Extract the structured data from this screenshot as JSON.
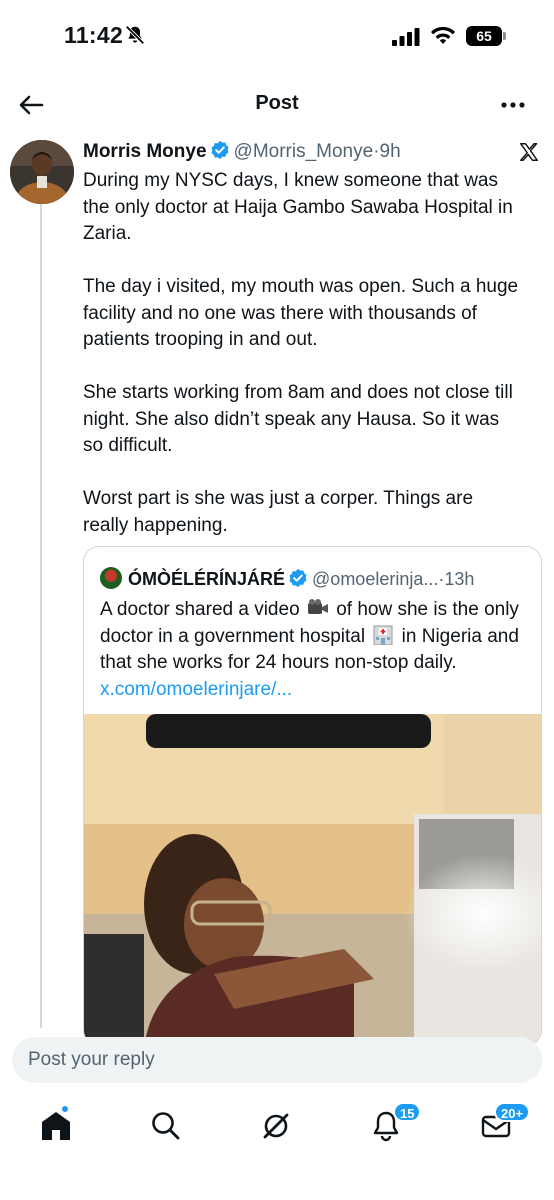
{
  "status_bar": {
    "time": "11:42",
    "battery": "65"
  },
  "header": {
    "title": "Post"
  },
  "tweet": {
    "author_name": "Morris Monye",
    "handle": "@Morris_Monye",
    "separator": "·",
    "time": "9h",
    "paragraphs": [
      "During my NYSC days, I knew someone that was the only doctor at Haija Gambo Sawaba Hospital in Zaria.",
      "The day i visited, my mouth was open. Such a huge facility and no one was there with thousands of patients trooping in and out.",
      "She starts working from 8am and does not close till night. She also didn’t speak any Hausa. So it was so difficult.",
      "Worst part is she was just a corper. Things are really happening."
    ]
  },
  "quote": {
    "author_name": "ÓMÒÉLÉRÍNJÁRÉ",
    "handle": "@omoelerinja...",
    "separator": "·",
    "time": "13h",
    "text_part1": "A doctor shared a video",
    "text_part2": "of how she is the only doctor in a government hospital",
    "text_part3": "in Nigeria and that she works for 24 hours non-stop daily.",
    "link": "x.com/omoelerinjare/..."
  },
  "reply": {
    "placeholder": "Post your reply"
  },
  "nav": {
    "notifications_badge": "15",
    "messages_badge": "20+"
  },
  "colors": {
    "accent": "#1d9bf0",
    "text": "#0f1419",
    "muted": "#536471"
  }
}
